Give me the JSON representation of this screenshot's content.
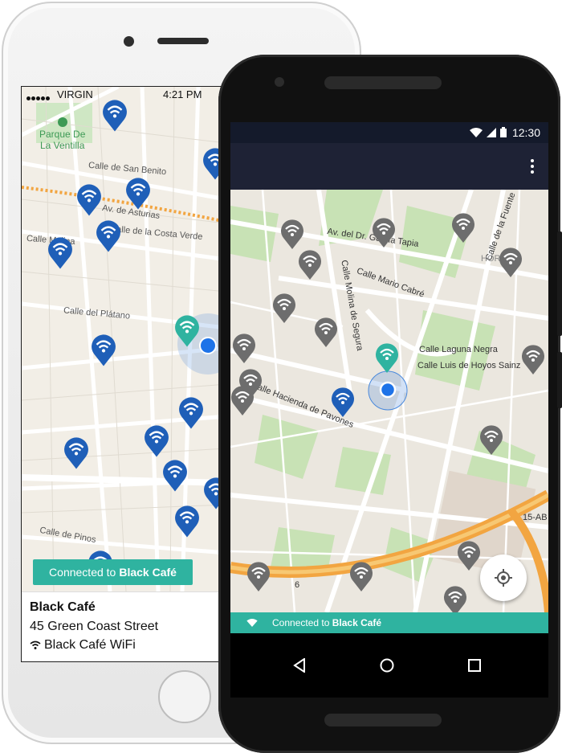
{
  "ios": {
    "status": {
      "carrier": "VIRGIN",
      "time": "4:21 PM"
    },
    "park_label_line1": "Parque De",
    "park_label_line2": "La Ventilla",
    "streets": [
      "Calle de San Benito",
      "Av. de Asturias",
      "Calle de la Costa Verde",
      "Calle Molina",
      "Calle del Plátano",
      "Calle de Pinos"
    ],
    "connected_prefix": "Connected to",
    "connected_name": "Black Café",
    "place": {
      "name": "Black Café",
      "address": "45 Green Coast Street",
      "wifi": "Black Café WiFi"
    }
  },
  "android": {
    "status": {
      "time": "12:30"
    },
    "streets": [
      "Av. del Dr. García Tapia",
      "Calle Mario Cabré",
      "Calle Molina de Segura",
      "Calle Laguna Negra",
      "Calle Luis de Hoyos Sainz",
      "Calle Hacienda de Pavones",
      "Calle de la Fuente",
      "HOR",
      "15-AB",
      "6"
    ],
    "connected_prefix": "Connected to",
    "connected_name": "Black Café"
  },
  "colors": {
    "accent": "#2fb3a0",
    "pin_blue": "#1f5fb8",
    "pin_gray": "#6d6d6d",
    "android_toolbar": "#1e2235",
    "highway": "#f2a541"
  },
  "icons": [
    "wifi-pin-icon",
    "location-dot-icon",
    "my-location-icon",
    "more-vert-icon",
    "back-icon",
    "home-icon",
    "recents-icon",
    "wifi-icon",
    "signal-icon",
    "battery-icon"
  ]
}
